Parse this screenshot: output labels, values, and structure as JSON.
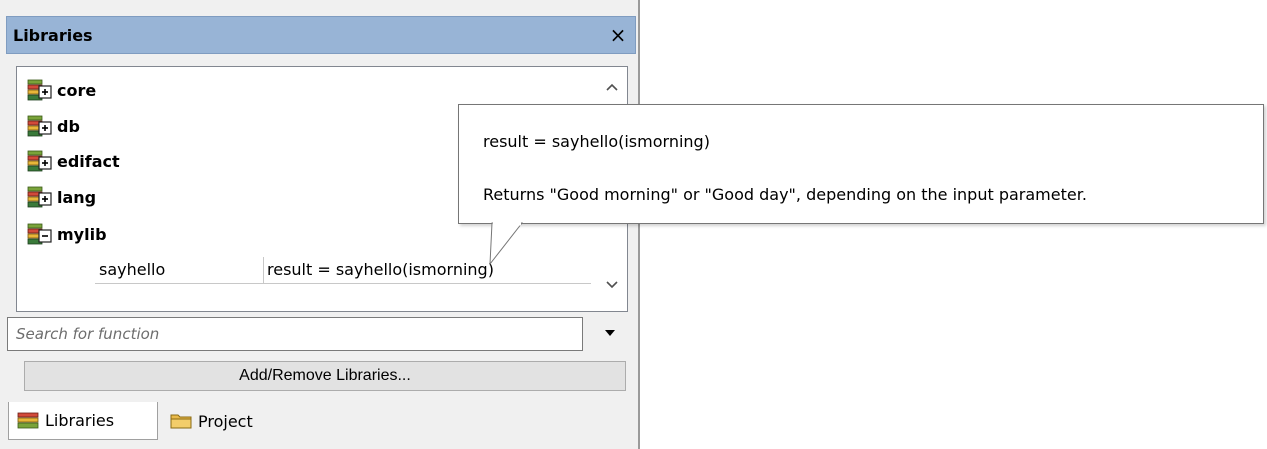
{
  "panel": {
    "title": "Libraries",
    "close_glyph": "×"
  },
  "libraries": [
    {
      "label": "core",
      "state": "collapsed",
      "icon": "library-stack-plus-icon"
    },
    {
      "label": "db",
      "state": "collapsed",
      "icon": "library-stack-plus-icon"
    },
    {
      "label": "edifact",
      "state": "collapsed",
      "icon": "library-stack-plus-icon"
    },
    {
      "label": "lang",
      "state": "collapsed",
      "icon": "library-stack-plus-icon"
    },
    {
      "label": "mylib",
      "state": "expanded",
      "icon": "library-stack-minus-icon"
    }
  ],
  "functions": [
    {
      "name": "sayhello",
      "signature": "result = sayhello(ismorning)"
    }
  ],
  "search": {
    "placeholder": "Search for function"
  },
  "add_remove_label": "Add/Remove Libraries...",
  "tabs": [
    {
      "label": "Libraries",
      "icon": "libraries-icon",
      "active": true
    },
    {
      "label": "Project",
      "icon": "folder-icon",
      "active": false
    }
  ],
  "tooltip": {
    "signature": "result = sayhello(ismorning)",
    "description": "Returns \"Good morning\" or \"Good day\", depending on the input parameter."
  },
  "colors": {
    "titlebar": "#98b4d6",
    "panel_bg": "#f0f0f0"
  }
}
